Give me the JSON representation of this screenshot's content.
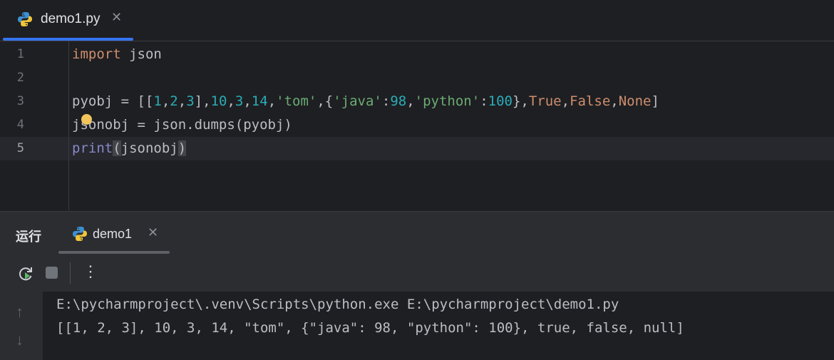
{
  "editor_tab": {
    "filename": "demo1.py",
    "close": "✕"
  },
  "editor": {
    "line_numbers": [
      "1",
      "2",
      "3",
      "4",
      "5"
    ]
  },
  "run_panel": {
    "title": "运行",
    "tab_name": "demo1",
    "close": "✕",
    "more": "⋮",
    "arrow_up": "↑",
    "arrow_down": "↓"
  },
  "console": {
    "lines": [
      "E:\\pycharmproject\\.venv\\Scripts\\python.exe E:\\pycharmproject\\demo1.py",
      "[[1, 2, 3], 10, 3, 14, \"tom\", {\"java\": 98, \"python\": 100}, true, false, null]"
    ]
  },
  "colors": {
    "accent": "#3574f0",
    "keyword": "#cf8e6d",
    "number": "#2aacb8",
    "string": "#6aab73",
    "builtin": "#8888c6",
    "bulb": "#f2c55c"
  },
  "icons": {
    "file_tab": "python-file-icon",
    "run_tab": "python-run-icon",
    "rerun": "rerun-icon",
    "stop": "stop-icon"
  }
}
